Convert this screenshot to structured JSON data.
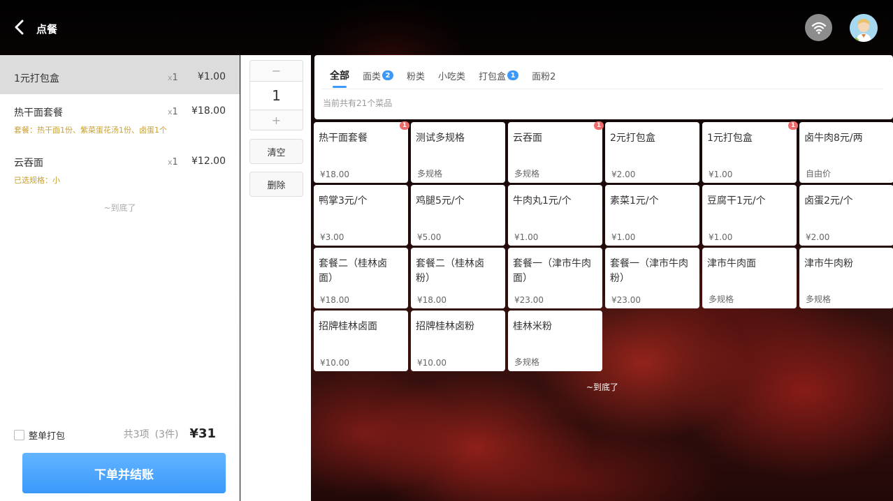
{
  "header": {
    "title": "点餐"
  },
  "cart": {
    "items": [
      {
        "name": "1元打包盒",
        "qty_prefix": "x",
        "qty": "1",
        "price": "¥1.00",
        "note": ""
      },
      {
        "name": "热干面套餐",
        "qty_prefix": "x",
        "qty": "1",
        "price": "¥18.00",
        "note": "套餐：热干面1份、紫菜蛋花汤1份、卤蛋1个"
      },
      {
        "name": "云吞面",
        "qty_prefix": "x",
        "qty": "1",
        "price": "¥12.00",
        "note": "已选规格：小"
      }
    ],
    "end_text": "~到底了",
    "pack_all_label": "整单打包",
    "total_count": "共3项",
    "total_pieces": "(3件)",
    "total_amount": "¥31",
    "checkout_label": "下单并结账"
  },
  "controls": {
    "minus": "−",
    "quantity": "1",
    "plus": "+",
    "clear_label": "清空",
    "delete_label": "删除"
  },
  "categories": {
    "tabs": [
      {
        "label": "全部",
        "badge": ""
      },
      {
        "label": "面类",
        "badge": "2"
      },
      {
        "label": "粉类",
        "badge": ""
      },
      {
        "label": "小吃类",
        "badge": ""
      },
      {
        "label": "打包盒",
        "badge": "1"
      },
      {
        "label": "面粉2",
        "badge": ""
      }
    ],
    "count_text": "当前共有21个菜品"
  },
  "dishes": [
    {
      "name": "热干面套餐",
      "price": "¥18.00",
      "badge": "1"
    },
    {
      "name": "测试多规格",
      "price": "多规格",
      "badge": ""
    },
    {
      "name": "云吞面",
      "price": "多规格",
      "badge": "1"
    },
    {
      "name": "2元打包盒",
      "price": "¥2.00",
      "badge": ""
    },
    {
      "name": "1元打包盒",
      "price": "¥1.00",
      "badge": "1"
    },
    {
      "name": "卤牛肉8元/两",
      "price": "自由价",
      "badge": ""
    },
    {
      "name": "鸭掌3元/个",
      "price": "¥3.00",
      "badge": ""
    },
    {
      "name": "鸡腿5元/个",
      "price": "¥5.00",
      "badge": ""
    },
    {
      "name": "牛肉丸1元/个",
      "price": "¥1.00",
      "badge": ""
    },
    {
      "name": "素菜1元/个",
      "price": "¥1.00",
      "badge": ""
    },
    {
      "name": "豆腐干1元/个",
      "price": "¥1.00",
      "badge": ""
    },
    {
      "name": "卤蛋2元/个",
      "price": "¥2.00",
      "badge": ""
    },
    {
      "name": "套餐二（桂林卤面）",
      "price": "¥18.00",
      "badge": ""
    },
    {
      "name": "套餐二（桂林卤粉）",
      "price": "¥18.00",
      "badge": ""
    },
    {
      "name": "套餐一（津市牛肉面）",
      "price": "¥23.00",
      "badge": ""
    },
    {
      "name": "套餐一（津市牛肉粉）",
      "price": "¥23.00",
      "badge": ""
    },
    {
      "name": "津市牛肉面",
      "price": "多规格",
      "badge": ""
    },
    {
      "name": "津市牛肉粉",
      "price": "多规格",
      "badge": ""
    },
    {
      "name": "招牌桂林卤面",
      "price": "¥10.00",
      "badge": ""
    },
    {
      "name": "招牌桂林卤粉",
      "price": "¥10.00",
      "badge": ""
    },
    {
      "name": "桂林米粉",
      "price": "多规格",
      "badge": ""
    }
  ],
  "grid_end_text": "~到底了",
  "colors": {
    "accent": "#3b99fb",
    "badge": "#ee6b6b",
    "note": "#c8a032",
    "selected_row": "#dcdcdc"
  }
}
